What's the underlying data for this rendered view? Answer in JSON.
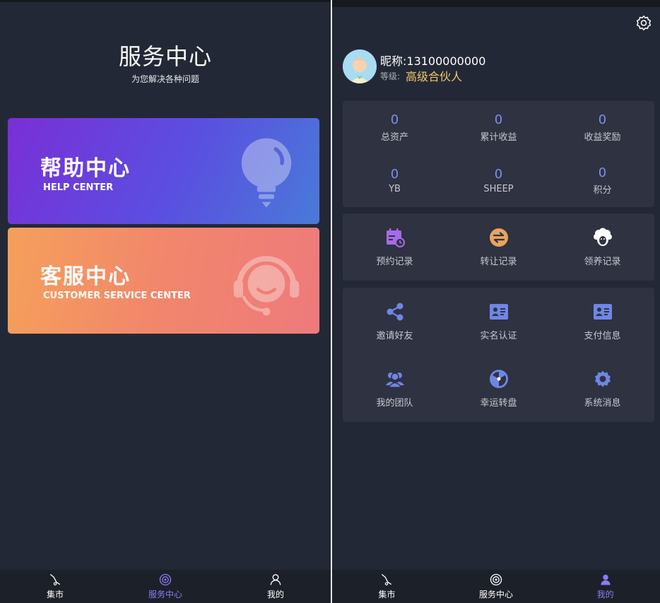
{
  "left": {
    "title": "服务中心",
    "subtitle": "为您解决各种问题",
    "banners": [
      {
        "title": "帮助中心",
        "subtitle": "HELP CENTER",
        "icon": "lightbulb-icon"
      },
      {
        "title": "客服中心",
        "subtitle": "CUSTOMER SERVICE CENTER",
        "icon": "headset-agent-icon"
      }
    ],
    "tabbar": [
      {
        "label": "集市",
        "icon": "market-icon",
        "active": false
      },
      {
        "label": "服务中心",
        "icon": "service-icon",
        "active": true
      },
      {
        "label": "我的",
        "icon": "user-icon",
        "active": false
      }
    ]
  },
  "right": {
    "settings_icon": "gear-icon",
    "profile": {
      "nickname": "昵称:13100000000",
      "level_label": "等级:",
      "level_value": "高级合伙人"
    },
    "stats": [
      {
        "value": "0",
        "label": "总资产"
      },
      {
        "value": "0",
        "label": "累计收益"
      },
      {
        "value": "0",
        "label": "收益奖励"
      },
      {
        "value": "0",
        "label": "YB"
      },
      {
        "value": "0",
        "label": "SHEEP"
      },
      {
        "value": "0",
        "label": "积分"
      }
    ],
    "records": [
      {
        "label": "预约记录",
        "icon": "calendar-icon"
      },
      {
        "label": "转让记录",
        "icon": "transfer-icon"
      },
      {
        "label": "领养记录",
        "icon": "sheep-icon"
      }
    ],
    "services": [
      {
        "label": "邀请好友",
        "icon": "share-icon"
      },
      {
        "label": "实名认证",
        "icon": "id-card-icon"
      },
      {
        "label": "支付信息",
        "icon": "payment-card-icon"
      },
      {
        "label": "我的团队",
        "icon": "team-icon"
      },
      {
        "label": "幸运转盘",
        "icon": "lucky-wheel-icon"
      },
      {
        "label": "系统消息",
        "icon": "settings-cog-icon"
      }
    ],
    "tabbar": [
      {
        "label": "集市",
        "icon": "market-icon",
        "active": false
      },
      {
        "label": "服务中心",
        "icon": "service-icon",
        "active": false
      },
      {
        "label": "我的",
        "icon": "user-icon",
        "active": true
      }
    ]
  },
  "colors": {
    "background": "#232836",
    "card": "#2f3240",
    "accent_blue": "#7d8fef",
    "accent_purple": "#8d7bf2",
    "level_gold": "#f3c56a"
  }
}
